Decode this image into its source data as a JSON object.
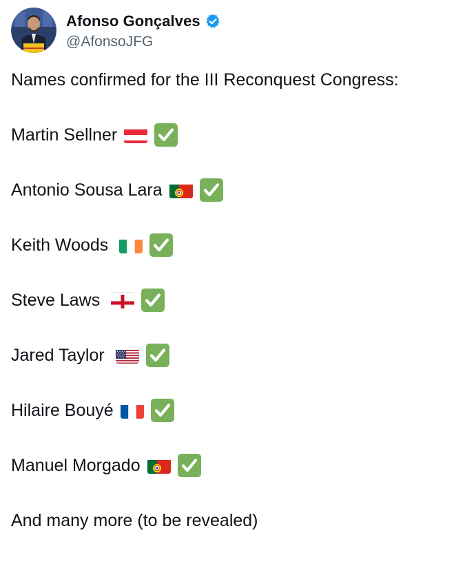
{
  "author": {
    "display_name": "Afonso Gonçalves",
    "handle": "@AfonsoJFG",
    "verified_icon": "verified-badge-icon",
    "accent": "#1d9bf0"
  },
  "tweet": {
    "intro": "Names confirmed for the III Reconquest Congress:",
    "entries": [
      {
        "name": "Martin Sellner",
        "flag": "austria-flag-icon"
      },
      {
        "name": "Antonio Sousa Lara",
        "flag": "portugal-flag-icon"
      },
      {
        "name": "Keith Woods",
        "flag": "ireland-flag-icon"
      },
      {
        "name": "Steve Laws",
        "flag": "england-flag-icon"
      },
      {
        "name": "Jared Taylor",
        "flag": "usa-flag-icon"
      },
      {
        "name": "Hilaire Bouyé",
        "flag": "france-flag-icon"
      },
      {
        "name": "Manuel Morgado",
        "flag": "portugal-flag-icon"
      }
    ],
    "check_icon": "check-mark-button-icon",
    "check_color": "#78b159",
    "outro": "And many more (to be revealed)"
  }
}
